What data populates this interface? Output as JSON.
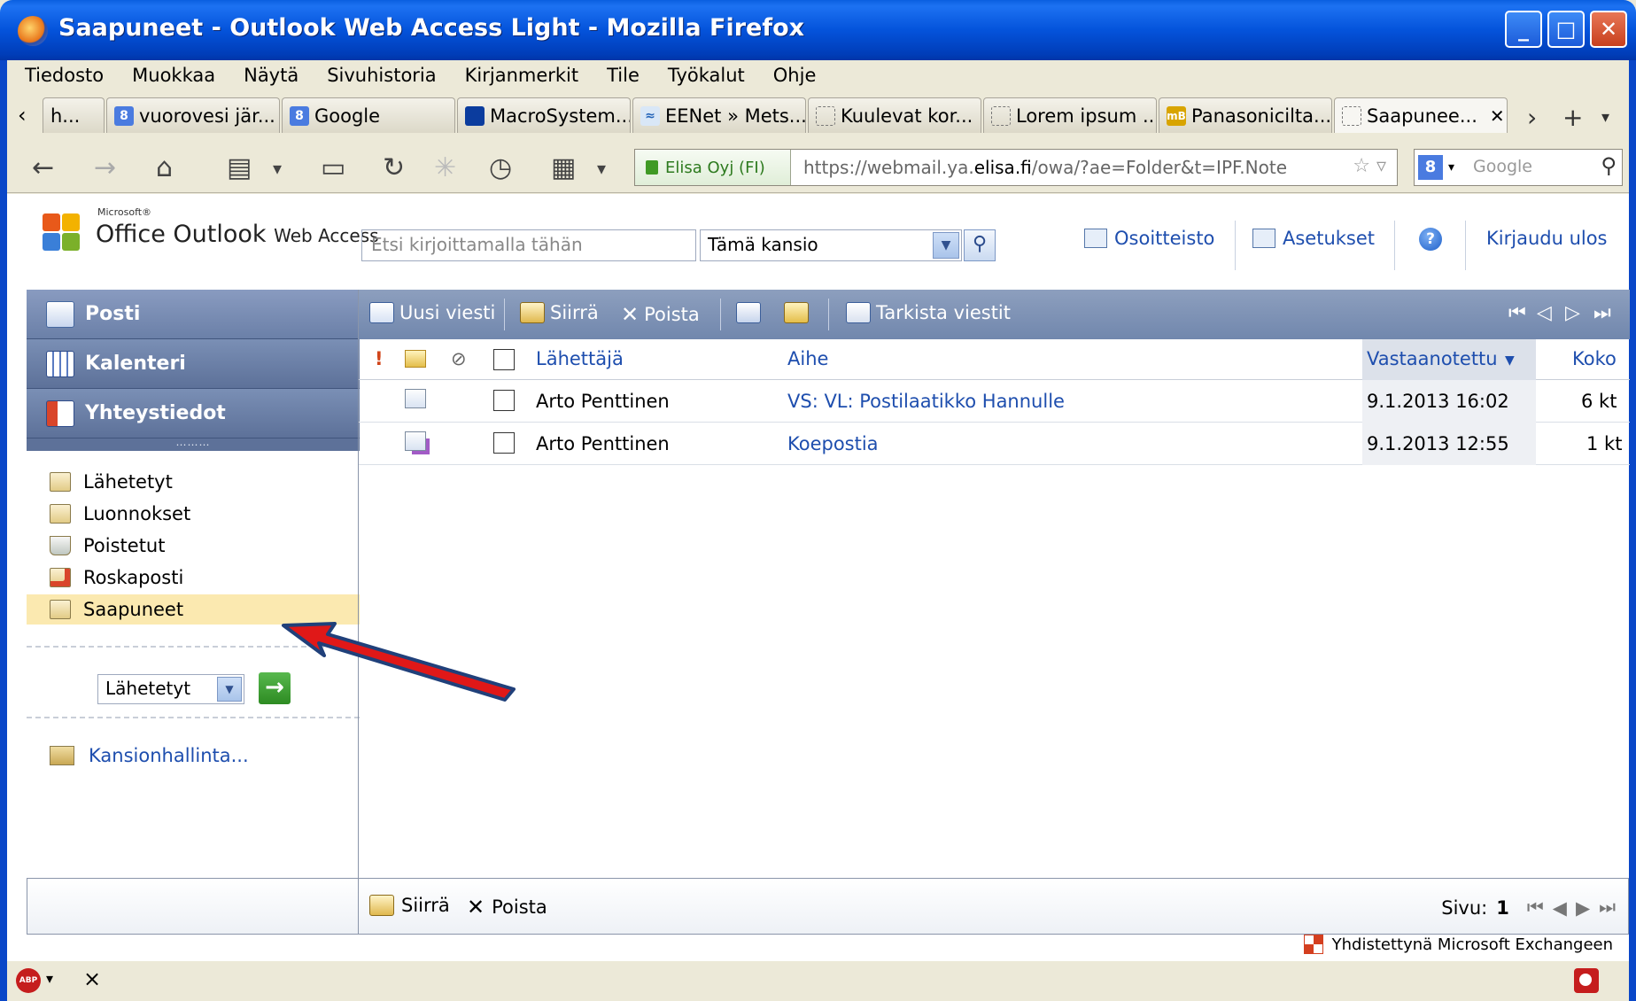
{
  "window": {
    "title": "Saapuneet - Outlook Web Access Light - Mozilla Firefox"
  },
  "menu": [
    "Tiedosto",
    "Muokkaa",
    "Näytä",
    "Sivuhistoria",
    "Kirjanmerkit",
    "Tile",
    "Työkalut",
    "Ohje"
  ],
  "tabs": [
    {
      "label": "h...",
      "icon": "blank"
    },
    {
      "label": "vuorovesi jär...",
      "icon": "google"
    },
    {
      "label": "Google",
      "icon": "google"
    },
    {
      "label": "MacroSystem...",
      "icon": "dark"
    },
    {
      "label": "EENet » Mets...",
      "icon": "ee"
    },
    {
      "label": "Kuulevat kor...",
      "icon": "blank"
    },
    {
      "label": "Lorem ipsum ...",
      "icon": "blank"
    },
    {
      "label": "Panasonicilta...",
      "icon": "mb"
    },
    {
      "label": "Saapunee...",
      "icon": "blank",
      "active": true
    }
  ],
  "nav": {
    "identity": "Elisa Oyj (FI)",
    "url_prefix": "https://webmail.ya.",
    "url_domain": "elisa.fi",
    "url_suffix": "/owa/?ae=Folder&t=IPF.Note",
    "search_placeholder": "Google"
  },
  "owa": {
    "logo_small": "Microsoft®",
    "logo_main": "Office Outlook",
    "logo_sub": "Web Access",
    "search_placeholder": "Etsi kirjoittamalla tähän",
    "scope": "Tämä kansio",
    "links": {
      "address_book": "Osoitteisto",
      "options": "Asetukset",
      "logout": "Kirjaudu ulos"
    }
  },
  "leftnav": {
    "modules": [
      "Posti",
      "Kalenteri",
      "Yhteystiedot"
    ],
    "folders": [
      "Lähetetyt",
      "Luonnokset",
      "Poistetut",
      "Roskaposti",
      "Saapuneet"
    ],
    "selected_folder": "Saapuneet",
    "move_select": "Lähetetyt",
    "manage": "Kansionhallinta..."
  },
  "toolbar": {
    "new": "Uusi viesti",
    "move": "Siirrä",
    "delete": "Poista",
    "check": "Tarkista viestit"
  },
  "columns": {
    "importance": "!",
    "from": "Lähettäjä",
    "subject": "Aihe",
    "received": "Vastaanotettu",
    "size": "Koko"
  },
  "messages": [
    {
      "from": "Arto Penttinen",
      "subject": "VS: VL: Postilaatikko Hannulle",
      "received": "9.1.2013 16:02",
      "size": "6 kt"
    },
    {
      "from": "Arto Penttinen",
      "subject": "Koepostia",
      "received": "9.1.2013 12:55",
      "size": "1 kt"
    }
  ],
  "bottom": {
    "move": "Siirrä",
    "delete": "Poista",
    "page_label": "Sivu:",
    "page": "1"
  },
  "footer": {
    "exchange": "Yhdistettynä Microsoft Exchangeen"
  },
  "colors": {
    "titlebar": "#0453DB",
    "nav_blue": "#6B80A8",
    "link": "#1E4EAE",
    "selected": "#FBE9B0",
    "arrow": "#E01818"
  }
}
